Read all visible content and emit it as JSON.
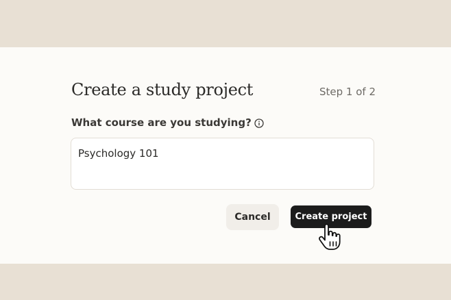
{
  "dialog": {
    "title": "Create a study project",
    "step": "Step 1 of 2",
    "question": "What course are you studying?",
    "info_icon": "info-circle-icon",
    "course_input": {
      "value": "Psychology 101"
    },
    "cancel_label": "Cancel",
    "create_label": "Create project",
    "cursor_icon": "hand-pointer-icon"
  },
  "colors": {
    "background": "#e8e0d4",
    "card": "#fcfbf8",
    "primary_button": "#1c1c1c",
    "secondary_button": "#f1eee9"
  }
}
